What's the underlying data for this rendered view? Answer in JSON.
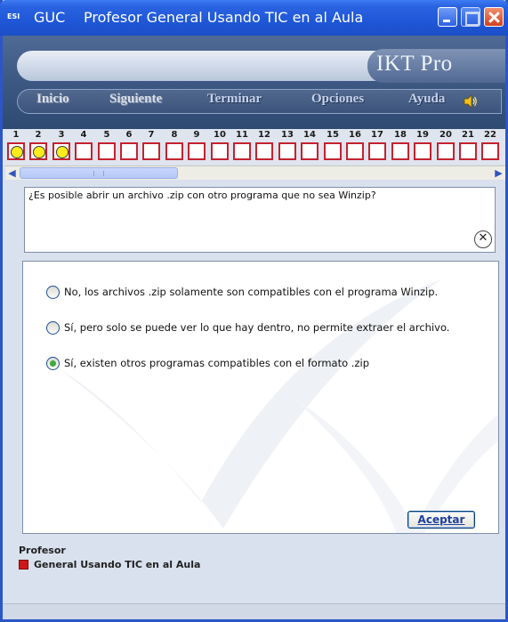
{
  "window": {
    "app_short": "GUC",
    "title": "Profesor General Usando TIC en al Aula",
    "icon_label": "ESI"
  },
  "brand": {
    "name": "IKT Pro"
  },
  "menu": [
    {
      "label": "Inicio",
      "enabled": false
    },
    {
      "label": "Siguiente",
      "enabled": false
    },
    {
      "label": "Terminar",
      "enabled": true
    },
    {
      "label": "Opciones",
      "enabled": true
    },
    {
      "label": "Ayuda",
      "enabled": true
    }
  ],
  "progress": {
    "numbers": [
      "1",
      "2",
      "3",
      "4",
      "5",
      "6",
      "7",
      "8",
      "9",
      "10",
      "11",
      "12",
      "13",
      "14",
      "15",
      "16",
      "17",
      "18",
      "19",
      "20",
      "21",
      "22"
    ],
    "answered": [
      true,
      true,
      true,
      false,
      false,
      false,
      false,
      false,
      false,
      false,
      false,
      false,
      false,
      false,
      false,
      false,
      false,
      false,
      false,
      false,
      false,
      false
    ]
  },
  "question": {
    "text": "¿Es posible abrir un archivo .zip con otro programa que no sea Winzip?"
  },
  "options": [
    {
      "text": "No, los archivos .zip solamente son compatibles con el programa Winzip.",
      "selected": false
    },
    {
      "text": "Sí, pero solo se puede ver lo que hay dentro, no permite extraer el archivo.",
      "selected": false
    },
    {
      "text": "Sí, existen otros programas compatibles con el formato .zip",
      "selected": true
    }
  ],
  "accept_label": "Aceptar",
  "footer": {
    "label": "Profesor",
    "item": "General Usando TIC en al Aula"
  },
  "colors": {
    "titlebar": "#1f57d8",
    "header": "#3e5a84",
    "box_border": "#c4222f",
    "answered_dot": "#ffec1a",
    "radio_selected": "#3eaa3a",
    "footer_square": "#d11818"
  }
}
